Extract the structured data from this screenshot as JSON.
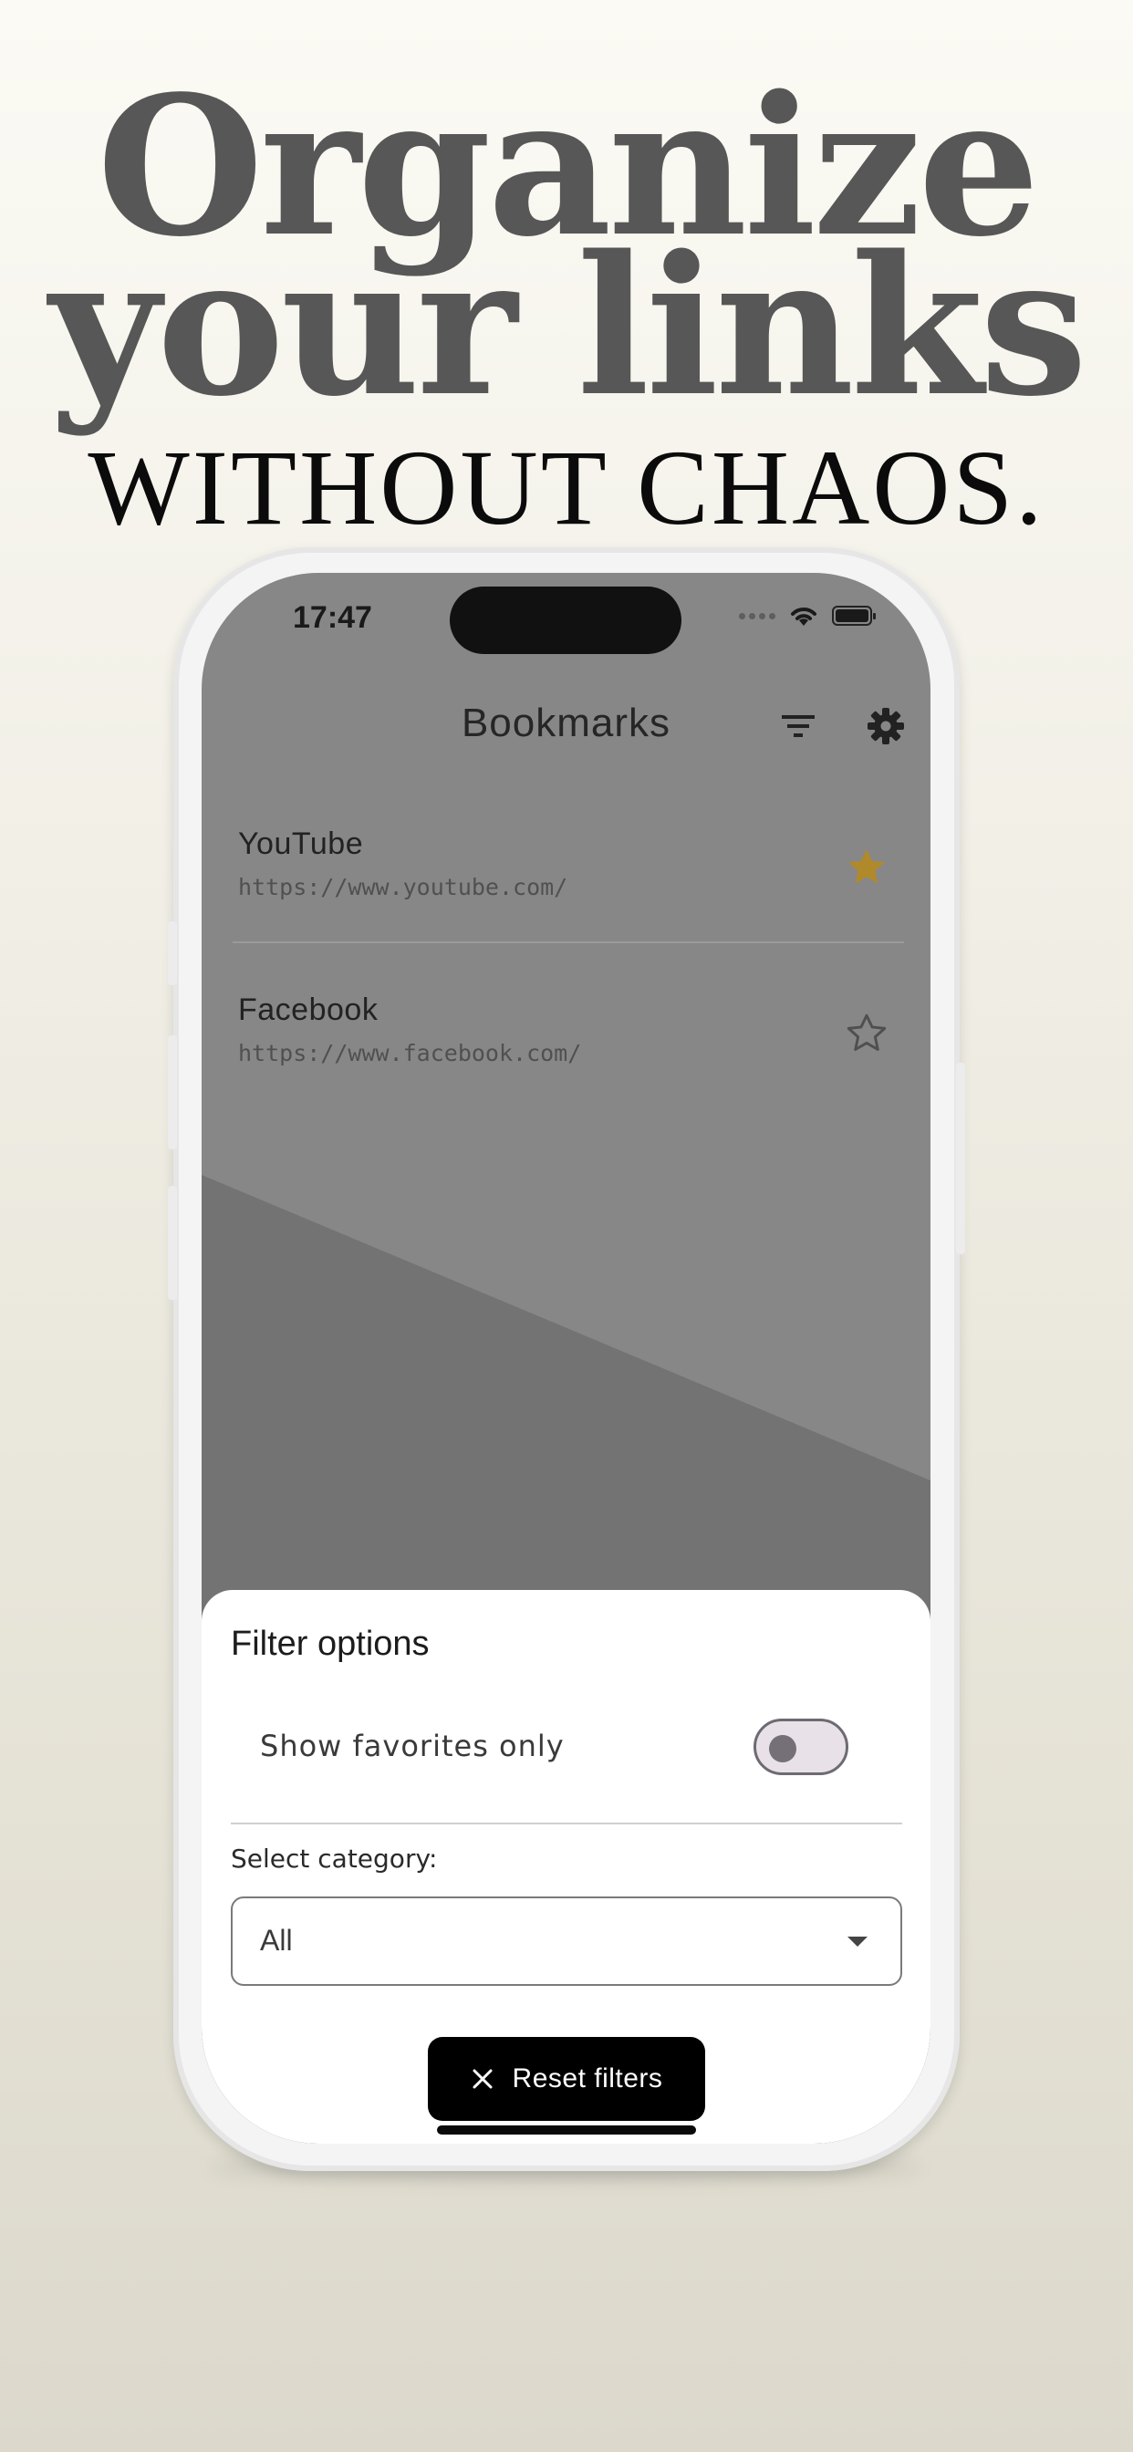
{
  "hero": {
    "line1": "Organize",
    "line2": "your links",
    "line3": "WITHOUT CHAOS."
  },
  "status_bar": {
    "time": "17:47",
    "signal_icon": "signal-dots-icon",
    "wifi_icon": "wifi-icon",
    "battery_icon": "battery-icon"
  },
  "app_bar": {
    "title": "Bookmarks",
    "filter_icon": "filter-icon",
    "settings_icon": "gear-icon"
  },
  "bookmarks": [
    {
      "name": "YouTube",
      "url": "https://www.youtube.com/",
      "favorite": true
    },
    {
      "name": "Facebook",
      "url": "https://www.facebook.com/",
      "favorite": false
    }
  ],
  "filter_sheet": {
    "title": "Filter options",
    "favorites_label": "Show favorites only",
    "favorites_on": false,
    "category_label": "Select category:",
    "category_value": "All",
    "reset_label": "Reset filters",
    "reset_icon": "close-icon"
  },
  "colors": {
    "star_active": "#b08a2a",
    "scrim": "#878787",
    "sheet": "#ffffff",
    "reset_button": "#000000"
  }
}
